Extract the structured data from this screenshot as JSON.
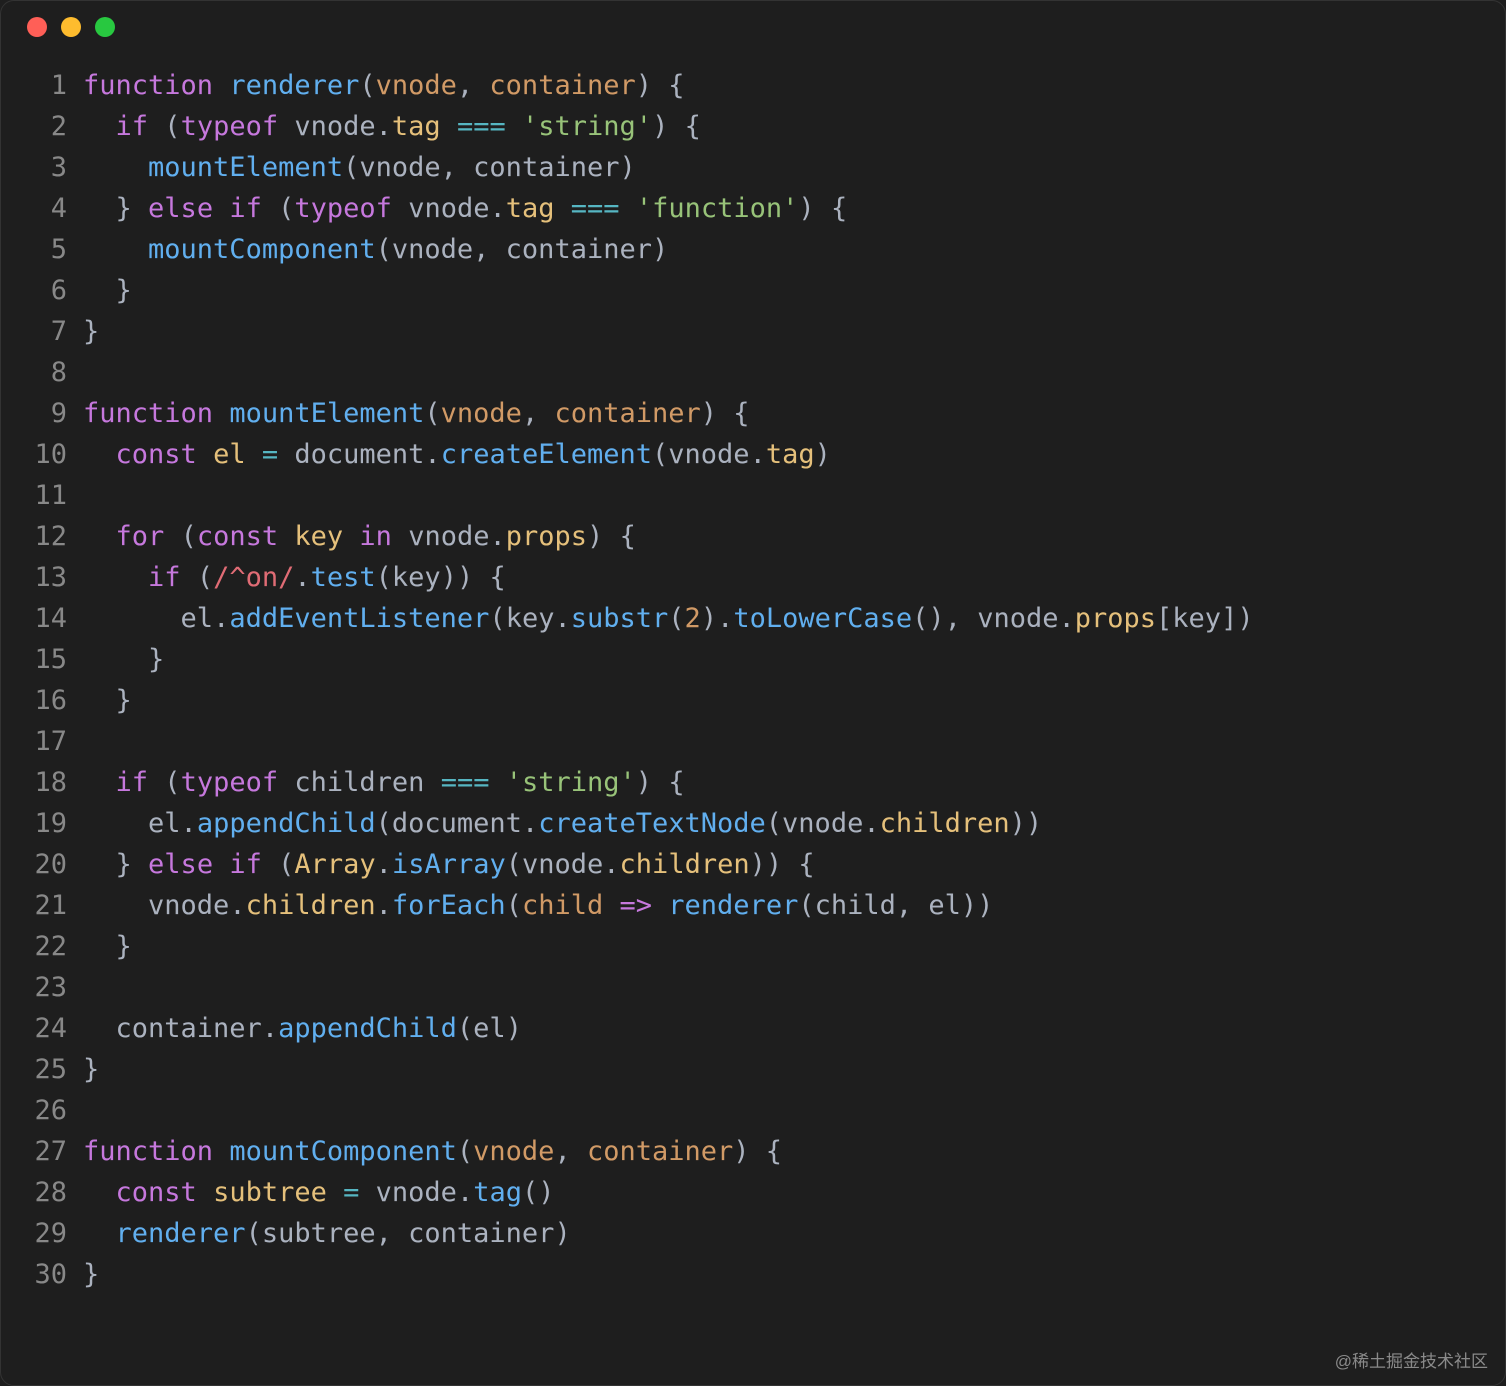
{
  "watermark": "@稀土掘金技术社区",
  "linenos": [
    "1",
    "2",
    "3",
    "4",
    "5",
    "6",
    "7",
    "8",
    "9",
    "10",
    "11",
    "12",
    "13",
    "14",
    "15",
    "16",
    "17",
    "18",
    "19",
    "20",
    "21",
    "22",
    "23",
    "24",
    "25",
    "26",
    "27",
    "28",
    "29",
    "30"
  ],
  "tok": {
    "function": "function",
    "if": "if",
    "else": "else",
    "typeof": "typeof",
    "const": "const",
    "for": "for",
    "in": "in",
    "renderer": "renderer",
    "mountElement": "mountElement",
    "mountComponent": "mountComponent",
    "vnode": "vnode",
    "container": "container",
    "tag": "tag",
    "props": "props",
    "children": "children",
    "el": "el",
    "key": "key",
    "subtree": "subtree",
    "child": "child",
    "document": "document",
    "createElement": "createElement",
    "createTextNode": "createTextNode",
    "appendChild": "appendChild",
    "addEventListener": "addEventListener",
    "substr": "substr",
    "toLowerCase": "toLowerCase",
    "forEach": "forEach",
    "isArray": "isArray",
    "Array": "Array",
    "test": "test",
    "str_string": "'string'",
    "str_function": "'function'",
    "regex_on": "/^on/",
    "num_2": "2",
    "eq": "===",
    "arrow": "=>",
    "assign": "=",
    "dot": ".",
    "comma": ", ",
    "lparen": "(",
    "rparen": ")",
    "lbrace": "{",
    "rbrace": "}",
    "lbrack": "[",
    "rbrack": "]"
  }
}
